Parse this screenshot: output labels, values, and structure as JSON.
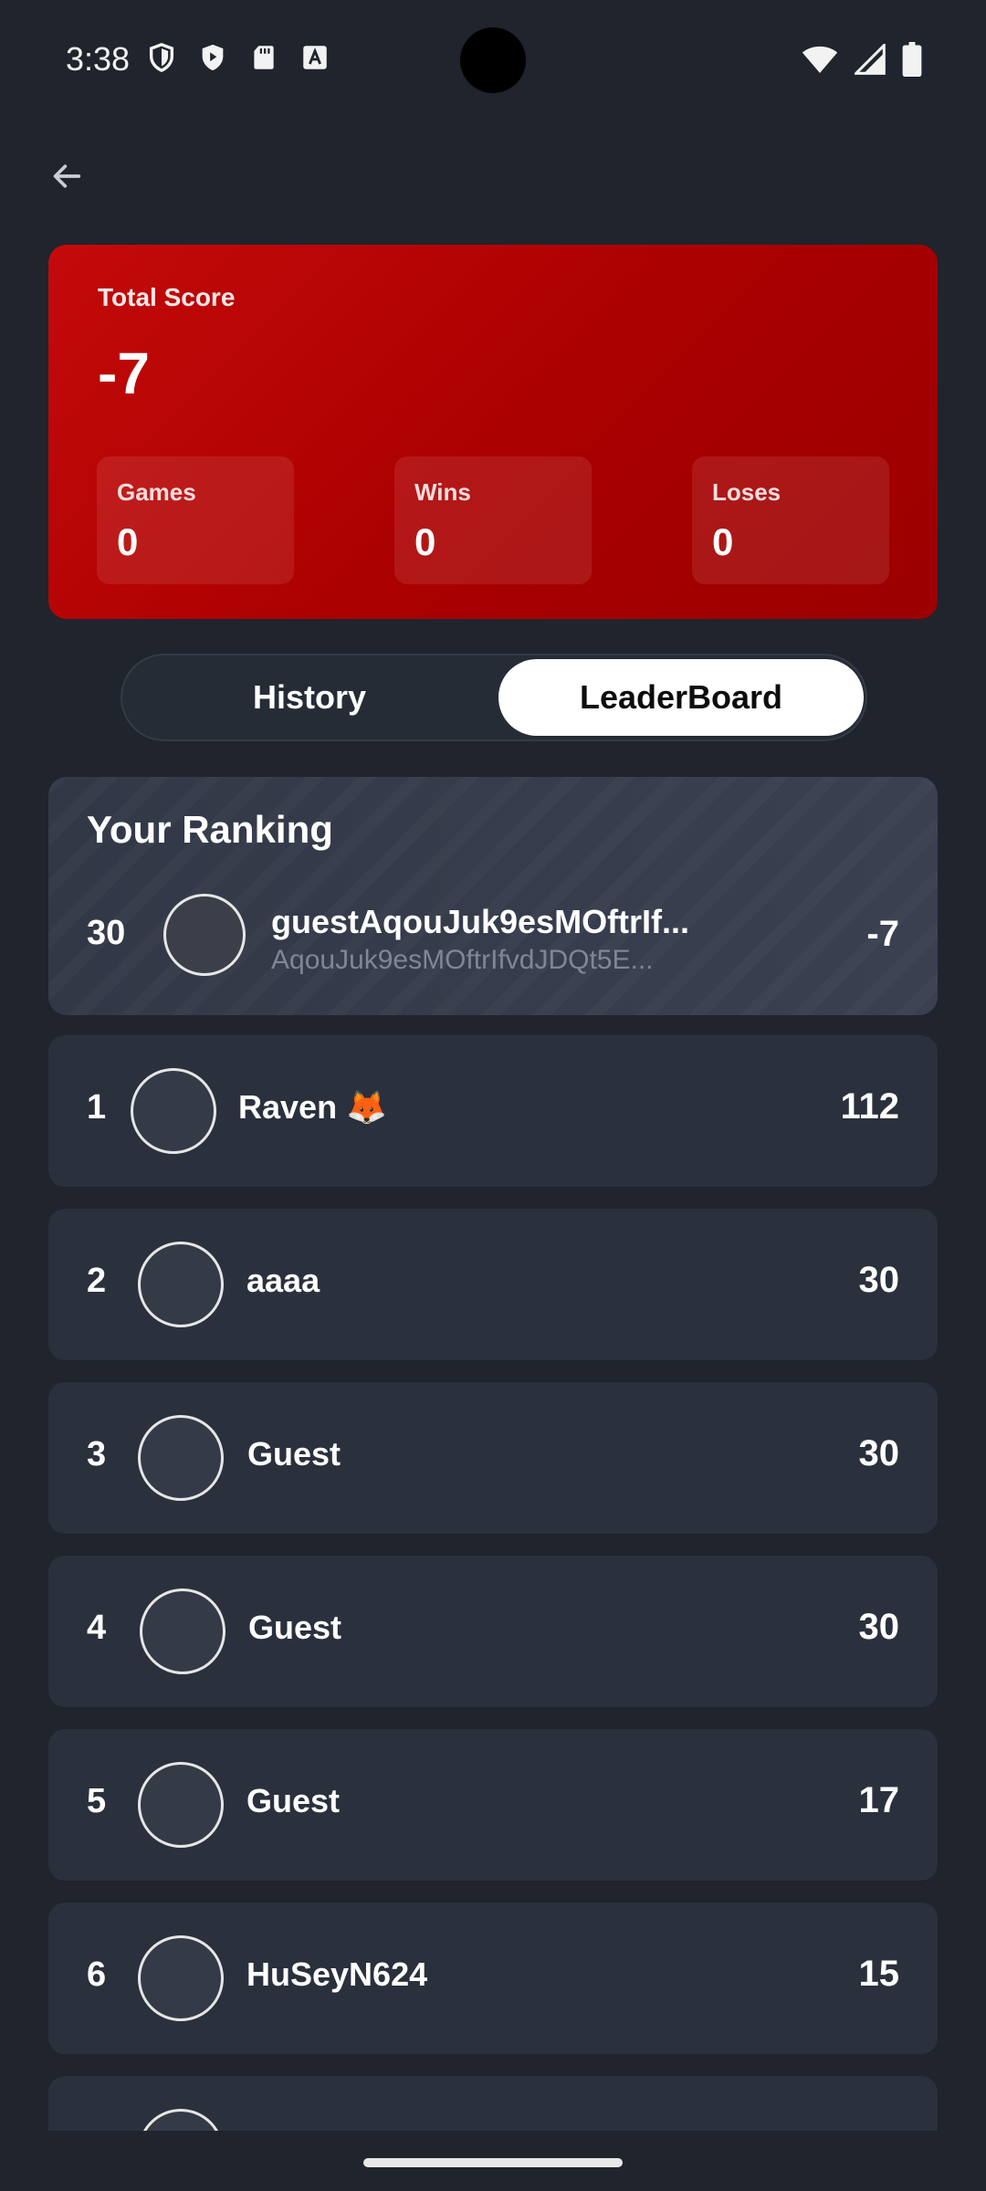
{
  "status_bar": {
    "time": "3:38",
    "left_icons": [
      "vpn-shield-icon",
      "play-protect-icon",
      "sd-card-icon",
      "font-a-icon"
    ],
    "right_icons": [
      "wifi-icon",
      "signal-icon",
      "battery-icon"
    ]
  },
  "header": {
    "back_icon": "arrow-left-icon"
  },
  "score_card": {
    "label": "Total Score",
    "value": "-7",
    "accent": "#b00000",
    "stats": [
      {
        "label": "Games",
        "value": "0"
      },
      {
        "label": "Wins",
        "value": "0"
      },
      {
        "label": "Loses",
        "value": "0"
      }
    ]
  },
  "tabs": {
    "items": [
      {
        "label": "History",
        "selected": false
      },
      {
        "label": "LeaderBoard",
        "selected": true
      }
    ]
  },
  "your_ranking": {
    "title": "Your Ranking",
    "rank": "30",
    "name": "guestAqouJuk9esMOftrIf...",
    "subtitle": "AqouJuk9esMOftrIfvdJDQt5E...",
    "score": "-7"
  },
  "leaderboard": {
    "rows": [
      {
        "rank": "1",
        "name": "Raven 🦊",
        "score": "112"
      },
      {
        "rank": "2",
        "name": "aaaa",
        "score": "30"
      },
      {
        "rank": "3",
        "name": "Guest",
        "score": "30"
      },
      {
        "rank": "4",
        "name": "Guest",
        "score": "30"
      },
      {
        "rank": "5",
        "name": "Guest",
        "score": "17"
      },
      {
        "rank": "6",
        "name": "HuSeyN624",
        "score": "15"
      }
    ]
  }
}
